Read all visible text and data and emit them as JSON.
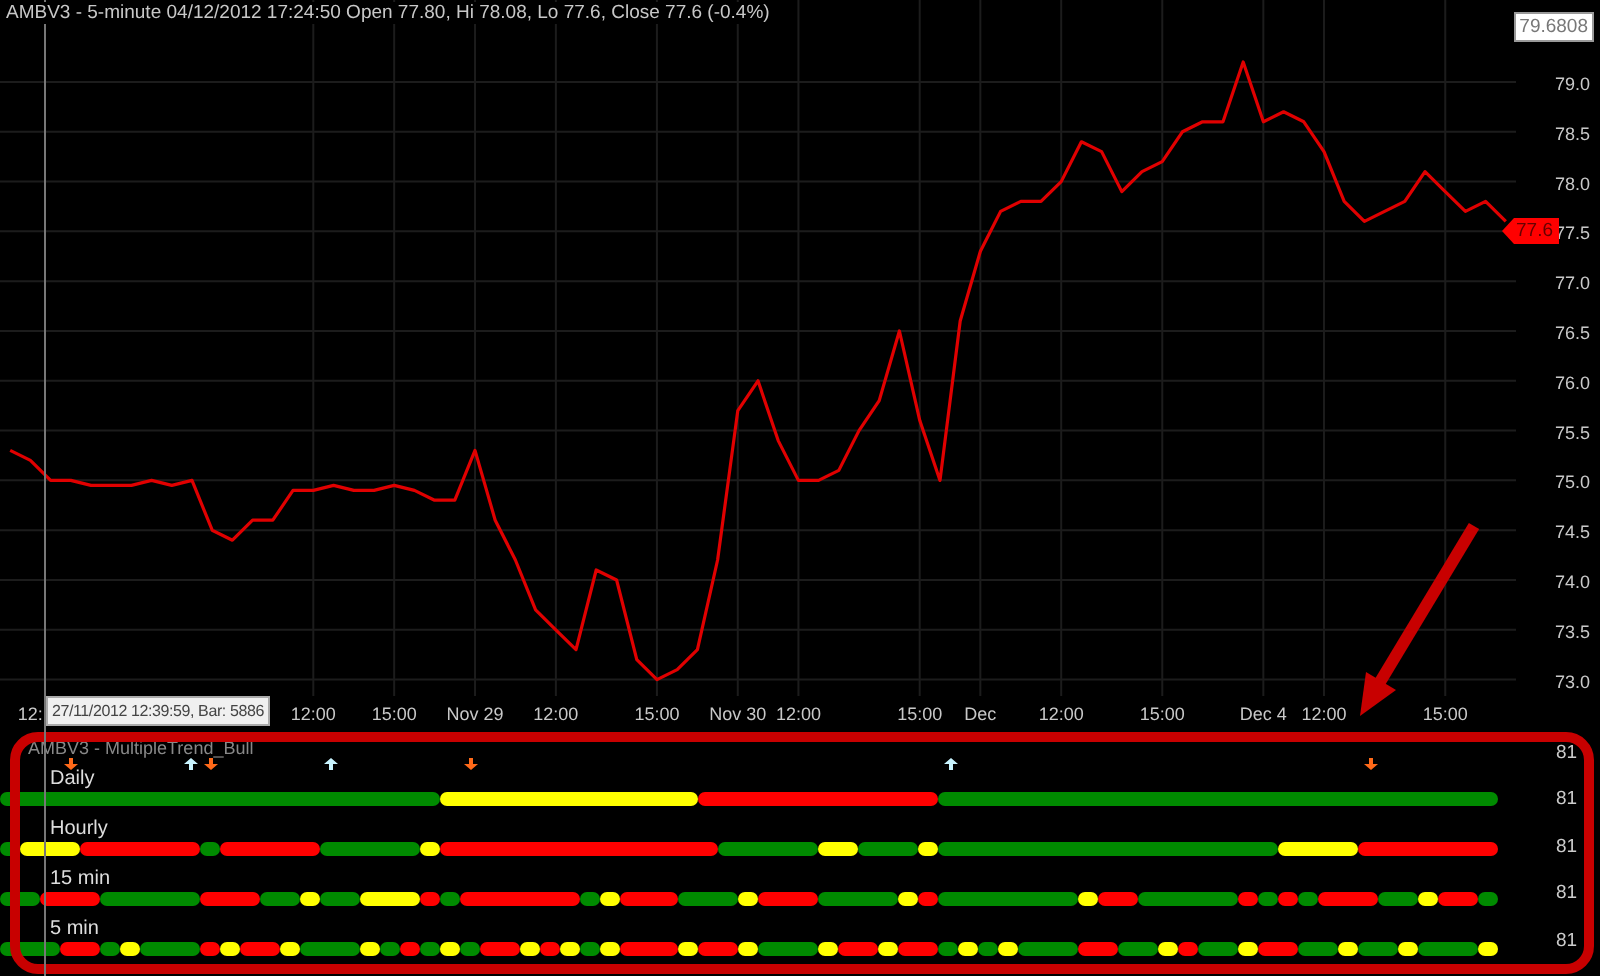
{
  "chart": {
    "title": "AMBV3 - 5-minute 04/12/2012 17:24:50 Open 77.80, Hi 78.08, Lo 77.6, Close 77.6 (-0.4%)",
    "cut_axis_label": "12:",
    "value_box": "79.6808",
    "price_tag": "77.6",
    "tooltip": "27/11/2012 12:39:59, Bar: 5886",
    "chart_data": {
      "type": "line",
      "grid": true,
      "ylim": [
        72.835,
        79.823
      ],
      "categories": [
        null,
        null,
        null,
        null,
        null,
        null,
        null,
        null,
        null,
        null,
        null,
        null,
        null,
        null,
        null,
        "12:00",
        null,
        null,
        null,
        "15:00",
        null,
        null,
        null,
        "Nov 29",
        null,
        null,
        null,
        "12:00",
        null,
        null,
        null,
        null,
        "15:00",
        null,
        null,
        null,
        "Nov 30",
        null,
        null,
        "12:00",
        null,
        null,
        null,
        null,
        null,
        "15:00",
        null,
        null,
        "Dec",
        null,
        null,
        null,
        "12:00",
        null,
        null,
        null,
        null,
        "15:00",
        null,
        null,
        null,
        null,
        "Dec 4",
        null,
        null,
        "12:00",
        null,
        null,
        null,
        null,
        null,
        "15:00",
        null,
        null,
        null
      ],
      "series": [
        {
          "color": "#e00000",
          "values": [
            75.3,
            75.2,
            75.0,
            75.0,
            74.95,
            74.95,
            74.95,
            75.0,
            74.95,
            75.0,
            74.5,
            74.4,
            74.6,
            74.6,
            74.9,
            74.9,
            74.95,
            74.9,
            74.9,
            74.95,
            74.9,
            74.8,
            74.8,
            75.3,
            74.6,
            74.2,
            73.7,
            73.5,
            73.3,
            74.1,
            74.0,
            73.2,
            73.0,
            73.1,
            73.3,
            74.2,
            75.7,
            76.0,
            75.4,
            75.0,
            75.0,
            75.1,
            75.5,
            75.8,
            76.5,
            75.6,
            75.0,
            76.6,
            77.3,
            77.7,
            77.8,
            77.8,
            78.0,
            78.4,
            78.3,
            77.9,
            78.1,
            78.2,
            78.5,
            78.6,
            78.6,
            79.2,
            78.6,
            78.7,
            78.6,
            78.3,
            77.8,
            77.6,
            77.7,
            77.8,
            78.1,
            77.9,
            77.7,
            77.8,
            77.6
          ]
        }
      ],
      "yticks": [
        {
          "value": 73,
          "label": "73.0"
        },
        {
          "value": 73.5,
          "label": "73.5"
        },
        {
          "value": 74,
          "label": "74.0"
        },
        {
          "value": 74.5,
          "label": "74.5"
        },
        {
          "value": 75,
          "label": "75.0"
        },
        {
          "value": 75.5,
          "label": "75.5"
        },
        {
          "value": 76,
          "label": "76.0"
        },
        {
          "value": 76.5,
          "label": "76.5"
        },
        {
          "value": 77,
          "label": "77.0"
        },
        {
          "value": 77.5,
          "label": "77.5"
        },
        {
          "value": 78,
          "label": "78.0"
        },
        {
          "value": 78.5,
          "label": "78.5"
        },
        {
          "value": 79,
          "label": "79.0"
        }
      ]
    }
  },
  "indicator": {
    "title": "AMBV3 - MultipleTrend_Bull",
    "axis_labels": [
      "81",
      "81",
      "81",
      "81",
      "81"
    ],
    "rows": [
      {
        "label": "Daily",
        "cells": [
          {
            "kind": "plain",
            "color": "#008a00"
          },
          {
            "kind": "plain",
            "color": "#008a00"
          },
          {
            "kind": "plain",
            "color": "#008a00"
          },
          {
            "kind": "down",
            "color": "#008a00"
          },
          {
            "kind": "plain",
            "color": "#008a00"
          },
          {
            "kind": "plain",
            "color": "#008a00"
          },
          {
            "kind": "plain",
            "color": "#008a00"
          },
          {
            "kind": "plain",
            "color": "#008a00"
          },
          {
            "kind": "plain",
            "color": "#008a00"
          },
          {
            "kind": "up",
            "color": "#008a00"
          },
          {
            "kind": "down",
            "color": "#008a00"
          },
          {
            "kind": "plain",
            "color": "#008a00"
          },
          {
            "kind": "plain",
            "color": "#008a00"
          },
          {
            "kind": "plain",
            "color": "#008a00"
          },
          {
            "kind": "plain",
            "color": "#008a00"
          },
          {
            "kind": "plain",
            "color": "#008a00"
          },
          {
            "kind": "up",
            "color": "#008a00"
          },
          {
            "kind": "plain",
            "color": "#008a00"
          },
          {
            "kind": "plain",
            "color": "#008a00"
          },
          {
            "kind": "plain",
            "color": "#008a00"
          },
          {
            "kind": "plain",
            "color": "#008a00"
          },
          {
            "kind": "plain",
            "color": "#008a00"
          },
          {
            "kind": "plain",
            "color": "#ffff00"
          },
          {
            "kind": "down",
            "color": "#ffff00"
          },
          {
            "kind": "plain",
            "color": "#ffff00"
          },
          {
            "kind": "plain",
            "color": "#ffff00"
          },
          {
            "kind": "plain",
            "color": "#ffff00"
          },
          {
            "kind": "plain",
            "color": "#ffff00"
          },
          {
            "kind": "plain",
            "color": "#ffff00"
          },
          {
            "kind": "plain",
            "color": "#ffff00"
          },
          {
            "kind": "plain",
            "color": "#ffff00"
          },
          {
            "kind": "plain",
            "color": "#ffff00"
          },
          {
            "kind": "plain",
            "color": "#ffff00"
          },
          {
            "kind": "plain",
            "color": "#ffff00"
          },
          {
            "kind": "plain",
            "color": "#ffff00"
          },
          {
            "kind": "plain",
            "color": "#ff0000"
          },
          {
            "kind": "plain",
            "color": "#ff0000"
          },
          {
            "kind": "plain",
            "color": "#ff0000"
          },
          {
            "kind": "plain",
            "color": "#ff0000"
          },
          {
            "kind": "plain",
            "color": "#ff0000"
          },
          {
            "kind": "plain",
            "color": "#ff0000"
          },
          {
            "kind": "plain",
            "color": "#ff0000"
          },
          {
            "kind": "plain",
            "color": "#ff0000"
          },
          {
            "kind": "plain",
            "color": "#ff0000"
          },
          {
            "kind": "plain",
            "color": "#ff0000"
          },
          {
            "kind": "plain",
            "color": "#ff0000"
          },
          {
            "kind": "plain",
            "color": "#ff0000"
          },
          {
            "kind": "up",
            "color": "#008a00"
          },
          {
            "kind": "plain",
            "color": "#008a00"
          },
          {
            "kind": "plain",
            "color": "#008a00"
          },
          {
            "kind": "plain",
            "color": "#008a00"
          },
          {
            "kind": "plain",
            "color": "#008a00"
          },
          {
            "kind": "plain",
            "color": "#008a00"
          },
          {
            "kind": "plain",
            "color": "#008a00"
          },
          {
            "kind": "plain",
            "color": "#008a00"
          },
          {
            "kind": "plain",
            "color": "#008a00"
          },
          {
            "kind": "plain",
            "color": "#008a00"
          },
          {
            "kind": "plain",
            "color": "#008a00"
          },
          {
            "kind": "plain",
            "color": "#008a00"
          },
          {
            "kind": "plain",
            "color": "#008a00"
          },
          {
            "kind": "plain",
            "color": "#008a00"
          },
          {
            "kind": "plain",
            "color": "#008a00"
          },
          {
            "kind": "plain",
            "color": "#008a00"
          },
          {
            "kind": "plain",
            "color": "#008a00"
          },
          {
            "kind": "plain",
            "color": "#008a00"
          },
          {
            "kind": "plain",
            "color": "#008a00"
          },
          {
            "kind": "plain",
            "color": "#008a00"
          },
          {
            "kind": "plain",
            "color": "#008a00"
          },
          {
            "kind": "down",
            "color": "#008a00"
          },
          {
            "kind": "plain",
            "color": "#008a00"
          },
          {
            "kind": "plain",
            "color": "#008a00"
          },
          {
            "kind": "plain",
            "color": "#008a00"
          },
          {
            "kind": "plain",
            "color": "#008a00"
          },
          {
            "kind": "plain",
            "color": "#008a00"
          },
          {
            "kind": "plain",
            "color": "#008a00"
          }
        ]
      },
      {
        "label": "Hourly",
        "cells": [
          {
            "color": "#008a00"
          },
          {
            "color": "#ffff00"
          },
          {
            "color": "#ffff00"
          },
          {
            "color": "#ffff00"
          },
          {
            "color": "#ff0000"
          },
          {
            "color": "#ff0000"
          },
          {
            "color": "#ff0000"
          },
          {
            "color": "#ff0000"
          },
          {
            "color": "#ff0000"
          },
          {
            "color": "#ff0000"
          },
          {
            "color": "#008a00"
          },
          {
            "color": "#ff0000"
          },
          {
            "color": "#ff0000"
          },
          {
            "color": "#ff0000"
          },
          {
            "color": "#ff0000"
          },
          {
            "color": "#ff0000"
          },
          {
            "color": "#008a00"
          },
          {
            "color": "#008a00"
          },
          {
            "color": "#008a00"
          },
          {
            "color": "#008a00"
          },
          {
            "color": "#008a00"
          },
          {
            "color": "#ffff00"
          },
          {
            "color": "#ff0000"
          },
          {
            "color": "#ff0000"
          },
          {
            "color": "#ff0000"
          },
          {
            "color": "#ff0000"
          },
          {
            "color": "#ff0000"
          },
          {
            "color": "#ff0000"
          },
          {
            "color": "#ff0000"
          },
          {
            "color": "#ff0000"
          },
          {
            "color": "#ff0000"
          },
          {
            "color": "#ff0000"
          },
          {
            "color": "#ff0000"
          },
          {
            "color": "#ff0000"
          },
          {
            "color": "#ff0000"
          },
          {
            "color": "#ff0000"
          },
          {
            "color": "#008a00"
          },
          {
            "color": "#008a00"
          },
          {
            "color": "#008a00"
          },
          {
            "color": "#008a00"
          },
          {
            "color": "#008a00"
          },
          {
            "color": "#ffff00"
          },
          {
            "color": "#ffff00"
          },
          {
            "color": "#008a00"
          },
          {
            "color": "#008a00"
          },
          {
            "color": "#008a00"
          },
          {
            "color": "#ffff00"
          },
          {
            "color": "#008a00"
          },
          {
            "color": "#008a00"
          },
          {
            "color": "#008a00"
          },
          {
            "color": "#008a00"
          },
          {
            "color": "#008a00"
          },
          {
            "color": "#008a00"
          },
          {
            "color": "#008a00"
          },
          {
            "color": "#008a00"
          },
          {
            "color": "#008a00"
          },
          {
            "color": "#008a00"
          },
          {
            "color": "#008a00"
          },
          {
            "color": "#008a00"
          },
          {
            "color": "#008a00"
          },
          {
            "color": "#008a00"
          },
          {
            "color": "#008a00"
          },
          {
            "color": "#008a00"
          },
          {
            "color": "#008a00"
          },
          {
            "color": "#ffff00"
          },
          {
            "color": "#ffff00"
          },
          {
            "color": "#ffff00"
          },
          {
            "color": "#ffff00"
          },
          {
            "color": "#ff0000"
          },
          {
            "color": "#ff0000"
          },
          {
            "color": "#ff0000"
          },
          {
            "color": "#ff0000"
          },
          {
            "color": "#ff0000"
          },
          {
            "color": "#ff0000"
          },
          {
            "color": "#ff0000"
          }
        ]
      },
      {
        "label": "15 min",
        "cells": [
          {
            "color": "#008a00"
          },
          {
            "color": "#008a00"
          },
          {
            "color": "#ff0000"
          },
          {
            "color": "#ff0000"
          },
          {
            "color": "#ff0000"
          },
          {
            "color": "#008a00"
          },
          {
            "color": "#008a00"
          },
          {
            "color": "#008a00"
          },
          {
            "color": "#008a00"
          },
          {
            "color": "#008a00"
          },
          {
            "color": "#ff0000"
          },
          {
            "color": "#ff0000"
          },
          {
            "color": "#ff0000"
          },
          {
            "color": "#008a00"
          },
          {
            "color": "#008a00"
          },
          {
            "color": "#ffff00"
          },
          {
            "color": "#008a00"
          },
          {
            "color": "#008a00"
          },
          {
            "color": "#ffff00"
          },
          {
            "color": "#ffff00"
          },
          {
            "color": "#ffff00"
          },
          {
            "color": "#ff0000"
          },
          {
            "color": "#008a00"
          },
          {
            "color": "#ff0000"
          },
          {
            "color": "#ff0000"
          },
          {
            "color": "#ff0000"
          },
          {
            "color": "#ff0000"
          },
          {
            "color": "#ff0000"
          },
          {
            "color": "#ff0000"
          },
          {
            "color": "#008a00"
          },
          {
            "color": "#ffff00"
          },
          {
            "color": "#ff0000"
          },
          {
            "color": "#ff0000"
          },
          {
            "color": "#ff0000"
          },
          {
            "color": "#008a00"
          },
          {
            "color": "#008a00"
          },
          {
            "color": "#008a00"
          },
          {
            "color": "#ffff00"
          },
          {
            "color": "#ff0000"
          },
          {
            "color": "#ff0000"
          },
          {
            "color": "#ff0000"
          },
          {
            "color": "#008a00"
          },
          {
            "color": "#008a00"
          },
          {
            "color": "#008a00"
          },
          {
            "color": "#008a00"
          },
          {
            "color": "#ffff00"
          },
          {
            "color": "#ff0000"
          },
          {
            "color": "#008a00"
          },
          {
            "color": "#008a00"
          },
          {
            "color": "#008a00"
          },
          {
            "color": "#008a00"
          },
          {
            "color": "#008a00"
          },
          {
            "color": "#008a00"
          },
          {
            "color": "#008a00"
          },
          {
            "color": "#ffff00"
          },
          {
            "color": "#ff0000"
          },
          {
            "color": "#ff0000"
          },
          {
            "color": "#008a00"
          },
          {
            "color": "#008a00"
          },
          {
            "color": "#008a00"
          },
          {
            "color": "#008a00"
          },
          {
            "color": "#008a00"
          },
          {
            "color": "#ff0000"
          },
          {
            "color": "#008a00"
          },
          {
            "color": "#ff0000"
          },
          {
            "color": "#008a00"
          },
          {
            "color": "#ff0000"
          },
          {
            "color": "#ff0000"
          },
          {
            "color": "#ff0000"
          },
          {
            "color": "#008a00"
          },
          {
            "color": "#008a00"
          },
          {
            "color": "#ffff00"
          },
          {
            "color": "#ff0000"
          },
          {
            "color": "#ff0000"
          },
          {
            "color": "#008a00"
          }
        ]
      },
      {
        "label": "5 min",
        "cells": [
          {
            "color": "#008a00"
          },
          {
            "color": "#008a00"
          },
          {
            "color": "#008a00"
          },
          {
            "color": "#ff0000"
          },
          {
            "color": "#ff0000"
          },
          {
            "color": "#008a00"
          },
          {
            "color": "#ffff00"
          },
          {
            "color": "#008a00"
          },
          {
            "color": "#008a00"
          },
          {
            "color": "#008a00"
          },
          {
            "color": "#ff0000"
          },
          {
            "color": "#ffff00"
          },
          {
            "color": "#ff0000"
          },
          {
            "color": "#ff0000"
          },
          {
            "color": "#ffff00"
          },
          {
            "color": "#008a00"
          },
          {
            "color": "#008a00"
          },
          {
            "color": "#008a00"
          },
          {
            "color": "#ffff00"
          },
          {
            "color": "#008a00"
          },
          {
            "color": "#ff0000"
          },
          {
            "color": "#008a00"
          },
          {
            "color": "#ffff00"
          },
          {
            "color": "#008a00"
          },
          {
            "color": "#ff0000"
          },
          {
            "color": "#ff0000"
          },
          {
            "color": "#ffff00"
          },
          {
            "color": "#ff0000"
          },
          {
            "color": "#ffff00"
          },
          {
            "color": "#008a00"
          },
          {
            "color": "#ffff00"
          },
          {
            "color": "#ff0000"
          },
          {
            "color": "#ff0000"
          },
          {
            "color": "#ff0000"
          },
          {
            "color": "#ffff00"
          },
          {
            "color": "#ff0000"
          },
          {
            "color": "#ff0000"
          },
          {
            "color": "#ffff00"
          },
          {
            "color": "#008a00"
          },
          {
            "color": "#008a00"
          },
          {
            "color": "#008a00"
          },
          {
            "color": "#ffff00"
          },
          {
            "color": "#ff0000"
          },
          {
            "color": "#ff0000"
          },
          {
            "color": "#ffff00"
          },
          {
            "color": "#ff0000"
          },
          {
            "color": "#ff0000"
          },
          {
            "color": "#008a00"
          },
          {
            "color": "#ffff00"
          },
          {
            "color": "#008a00"
          },
          {
            "color": "#ffff00"
          },
          {
            "color": "#008a00"
          },
          {
            "color": "#008a00"
          },
          {
            "color": "#008a00"
          },
          {
            "color": "#ff0000"
          },
          {
            "color": "#ff0000"
          },
          {
            "color": "#008a00"
          },
          {
            "color": "#008a00"
          },
          {
            "color": "#ffff00"
          },
          {
            "color": "#ff0000"
          },
          {
            "color": "#008a00"
          },
          {
            "color": "#008a00"
          },
          {
            "color": "#ffff00"
          },
          {
            "color": "#ff0000"
          },
          {
            "color": "#ff0000"
          },
          {
            "color": "#008a00"
          },
          {
            "color": "#008a00"
          },
          {
            "color": "#ffff00"
          },
          {
            "color": "#008a00"
          },
          {
            "color": "#008a00"
          },
          {
            "color": "#ffff00"
          },
          {
            "color": "#008a00"
          },
          {
            "color": "#008a00"
          },
          {
            "color": "#008a00"
          },
          {
            "color": "#ffff00"
          }
        ]
      }
    ]
  }
}
